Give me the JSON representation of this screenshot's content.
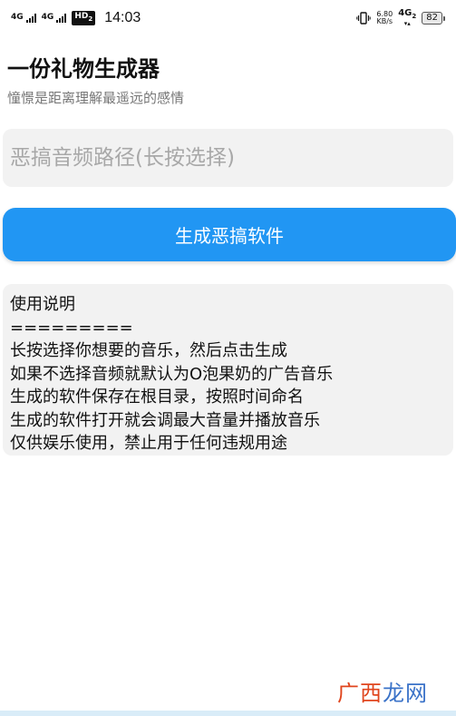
{
  "status_bar": {
    "sim1_label": "4G",
    "sim2_label": "4G",
    "hd_label": "HD",
    "hd_sub": "2",
    "time": "14:03",
    "net_speed_value": "6.80",
    "net_speed_unit": "KB/s",
    "net_type": "4G",
    "net_type_sub": "2",
    "battery": "82"
  },
  "header": {
    "title": "一份礼物生成器",
    "subtitle": "憧憬是距离理解最遥远的感情"
  },
  "path_input": {
    "placeholder": "恶搞音频路径(长按选择)",
    "value": ""
  },
  "generate_button": {
    "label": "生成恶搞软件"
  },
  "instructions": {
    "lines": [
      "使用说明",
      "=========",
      "长按选择你想要的音乐，然后点击生成",
      "如果不选择音频就默认为O泡果奶的广告音乐",
      "生成的软件保存在根目录，按照时间命名",
      "生成的软件打开就会调最大音量并播放音乐",
      "仅供娱乐使用，禁止用于任何违规用途"
    ]
  },
  "watermark": {
    "chars": [
      "广",
      "西",
      "龙",
      "网"
    ]
  },
  "colors": {
    "accent": "#2196f3",
    "panel_bg": "#f2f2f2",
    "subtitle": "#777777",
    "watermark_red": "#e0451d",
    "watermark_blue": "#3a72c8"
  }
}
